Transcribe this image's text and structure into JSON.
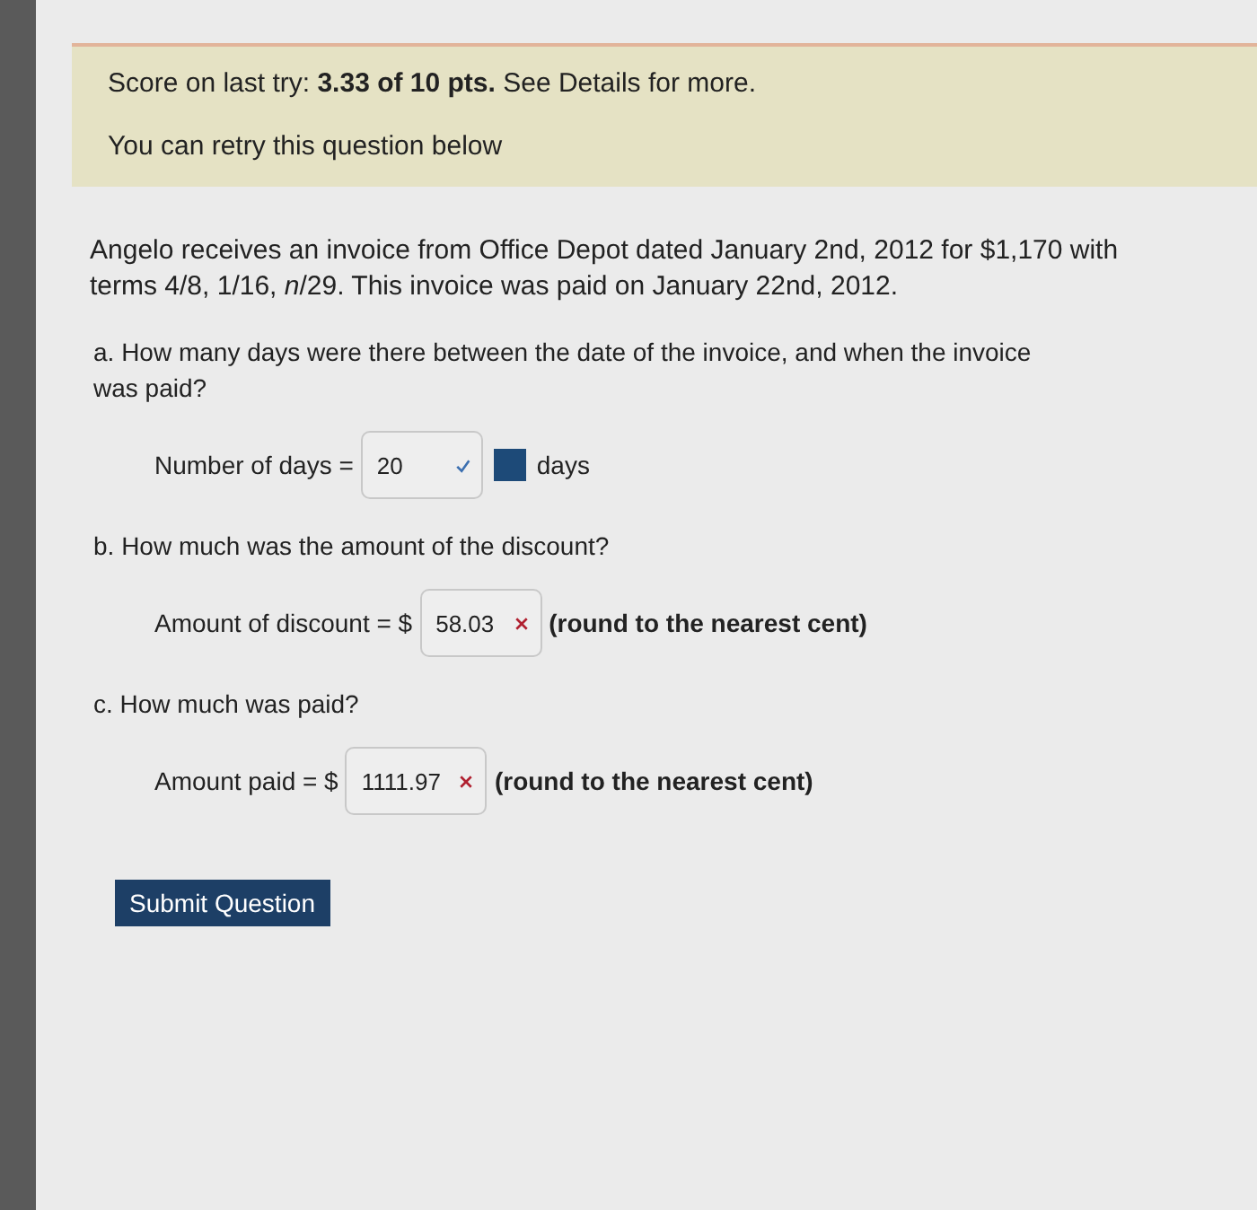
{
  "score_banner": {
    "score_text": "Score on last try: **3.33 of 10 pts.** See Details for more.",
    "retry_text": "You can retry this question below"
  },
  "question": "Angelo receives an invoice from Office Depot dated January 2nd, 2012 for $1,170 with terms 4/8, 1/16, *n*/29. This invoice was paid on January 22nd, 2012.",
  "parts": [
    {
      "prompt": "a. How many days were there between the date of the invoice, and when the invoice was paid?",
      "answer": {
        "label": "Number of days =",
        "value": "20",
        "correct": true,
        "unit": "days"
      }
    },
    {
      "prompt": "b. How much was the amount of the discount?",
      "answer": {
        "label": "Amount of discount = $",
        "value": "58.03",
        "correct": false,
        "note": "(round to the nearest cent)"
      }
    },
    {
      "prompt": "c. How much was paid?",
      "answer": {
        "label": "Amount paid = $",
        "value": "1111.97",
        "correct": false,
        "note": "(round to the nearest cent)"
      }
    }
  ],
  "submit_button": "Submit Question"
}
